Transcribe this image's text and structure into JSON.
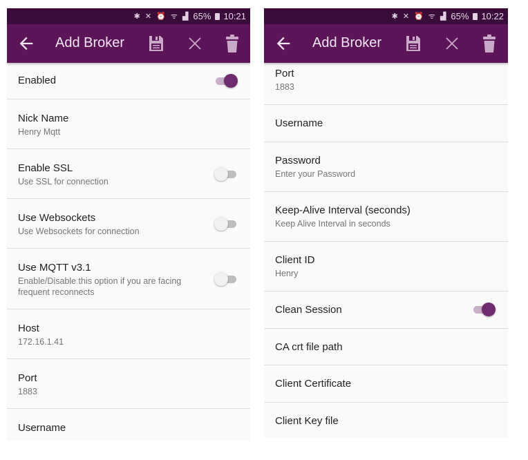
{
  "colors": {
    "status_bar": "#3a0c3a",
    "toolbar": "#5c1558",
    "accent": "#6e2b6e",
    "background": "#fafafa"
  },
  "screens": [
    {
      "status": {
        "icons": "bluetooth mute alarm wifi 4G signal",
        "battery": "65%",
        "time": "10:21"
      },
      "toolbar": {
        "title": "Add Broker",
        "back_icon": "arrow-left",
        "save_icon": "floppy-disk",
        "close_icon": "x",
        "delete_icon": "trash"
      },
      "items": [
        {
          "title": "Enabled",
          "subtitle": "",
          "toggle": true
        },
        {
          "title": "Nick Name",
          "subtitle": "Henry Mqtt"
        },
        {
          "title": "Enable SSL",
          "subtitle": "Use SSL for connection",
          "toggle": false
        },
        {
          "title": "Use Websockets",
          "subtitle": "Use Websockets for connection",
          "toggle": false
        },
        {
          "title": "Use MQTT v3.1",
          "subtitle": "Enable/Disable this option if you are facing frequent reconnects",
          "toggle": false
        },
        {
          "title": "Host",
          "subtitle": "172.16.1.41"
        },
        {
          "title": "Port",
          "subtitle": "1883"
        },
        {
          "title": "Username",
          "subtitle": ""
        }
      ]
    },
    {
      "status": {
        "icons": "bluetooth mute alarm wifi 4G signal",
        "battery": "65%",
        "time": "10:22"
      },
      "toolbar": {
        "title": "Add Broker",
        "back_icon": "arrow-left",
        "save_icon": "floppy-disk",
        "close_icon": "x",
        "delete_icon": "trash"
      },
      "items": [
        {
          "title": "Port",
          "subtitle": "1883"
        },
        {
          "title": "Username",
          "subtitle": ""
        },
        {
          "title": "Password",
          "subtitle": "Enter your Password"
        },
        {
          "title": "Keep-Alive Interval (seconds)",
          "subtitle": "Keep Alive Interval in seconds"
        },
        {
          "title": "Client ID",
          "subtitle": "Henry"
        },
        {
          "title": "Clean Session",
          "subtitle": "",
          "toggle": true
        },
        {
          "title": "CA crt file path",
          "subtitle": ""
        },
        {
          "title": "Client Certificate",
          "subtitle": ""
        },
        {
          "title": "Client Key file",
          "subtitle": ""
        }
      ]
    }
  ]
}
